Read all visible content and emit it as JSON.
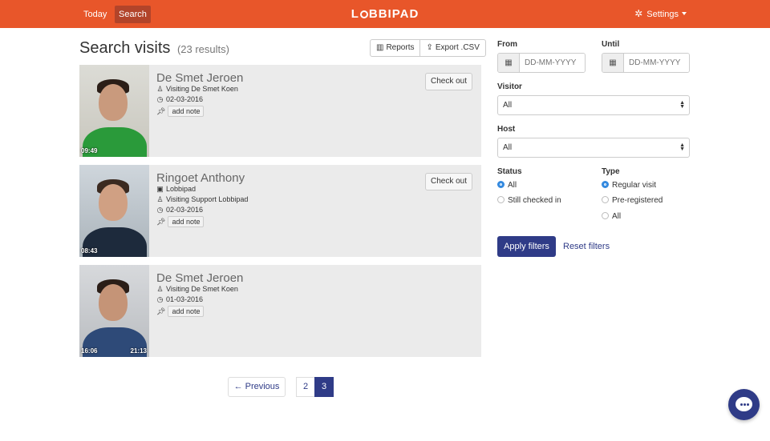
{
  "nav": {
    "today": "Today",
    "search": "Search"
  },
  "brand": {
    "left": "L",
    "right": "BBIPAD"
  },
  "settings": {
    "label": "Settings",
    "icon": "gear-icon"
  },
  "heading": {
    "title": "Search visits",
    "count": "(23 results)"
  },
  "toolbar": {
    "reports": "Reports",
    "export": "Export .CSV"
  },
  "visits": [
    {
      "name": "De Smet Jeroen",
      "company": "",
      "visiting": "Visiting De Smet Koen",
      "date": "02-03-2016",
      "note": "add note",
      "checkin_time": "09:49",
      "checkout_time": "",
      "action": "Check out"
    },
    {
      "name": "Ringoet Anthony",
      "company": "Lobbipad",
      "visiting": "Visiting Support Lobbipad",
      "date": "02-03-2016",
      "note": "add note",
      "checkin_time": "08:43",
      "checkout_time": "",
      "action": "Check out"
    },
    {
      "name": "De Smet Jeroen",
      "company": "",
      "visiting": "Visiting De Smet Koen",
      "date": "01-03-2016",
      "note": "add note",
      "checkin_time": "16:06",
      "checkout_time": "21:13",
      "action": ""
    }
  ],
  "pagination": {
    "previous": "← Previous",
    "pages": [
      "2",
      "3"
    ],
    "active": "3"
  },
  "filters": {
    "from_label": "From",
    "until_label": "Until",
    "date_placeholder": "DD-MM-YYYY",
    "visitor_label": "Visitor",
    "visitor_value": "All",
    "host_label": "Host",
    "host_value": "All",
    "status_label": "Status",
    "status_options": [
      "All",
      "Still checked in"
    ],
    "status_selected": "All",
    "type_label": "Type",
    "type_options": [
      "Regular visit",
      "Pre-registered",
      "All"
    ],
    "type_selected": "Regular visit",
    "apply": "Apply filters",
    "reset": "Reset filters"
  },
  "colors": {
    "brand": "#e8562a",
    "primary": "#2f3b87",
    "radio": "#2e86de"
  }
}
